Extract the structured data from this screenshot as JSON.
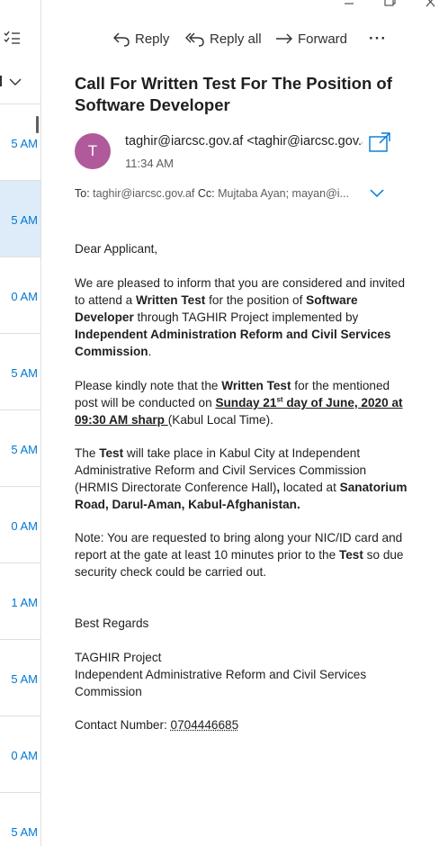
{
  "window": {
    "controls": [
      "minimize-icon",
      "restore-icon",
      "close-icon"
    ]
  },
  "list_pane": {
    "times": [
      "5 AM",
      "5 AM",
      "0 AM",
      "5 AM",
      "5 AM",
      "0 AM",
      "1 AM",
      "5 AM",
      "0 AM",
      "5 AM"
    ],
    "selected_index": 1
  },
  "toolbar": {
    "reply_label": "Reply",
    "reply_all_label": "Reply all",
    "forward_label": "Forward",
    "more_label": "···"
  },
  "message": {
    "subject": "Call For Written Test For The Position of Software Developer",
    "avatar_initial": "T",
    "avatar_color": "#b05a9b",
    "sender": "taghir@iarcsc.gov.af  <taghir@iarcsc.gov.af>",
    "time": "11:34 AM",
    "to_label": "To:",
    "to_value": "taghir@iarcsc.gov.af",
    "cc_label": "Cc:",
    "cc_value": "Mujtaba Ayan; mayan@i..."
  },
  "body": {
    "greeting": "Dear Applicant,",
    "p1_a": "We are pleased to inform that you are considered and invited to attend a ",
    "p1_b": "Written Test",
    "p1_c": " for the position of ",
    "p1_d": "Software Developer",
    "p1_e": " through TAGHIR Project implemented by ",
    "p1_f": "Independent Administration Reform and Civil Services Commission",
    "p1_g": ".",
    "p2_a": "Please kindly note that the ",
    "p2_b": "Written Test",
    "p2_c": " for the mentioned post will be conducted on ",
    "p2_d": "Sunday 21",
    "p2_sup": "st",
    "p2_e": " day of June, 2020 at 09:30 AM sharp ",
    "p2_f": "(Kabul Local Time).",
    "p3_a": "The ",
    "p3_b": "Test",
    "p3_c": " will take place in Kabul City at Independent Administrative Reform and Civil Services Commission (HRMIS Directorate Conference Hall)",
    "p3_d": ",",
    "p3_e": " located at ",
    "p3_f": "Sanatorium Road, Darul-Aman, Kabul-Afghanistan.",
    "p4_a": "Note: You are requested to bring along your NIC/ID card and report at the gate at least 10 minutes prior to the ",
    "p4_b": "Test",
    "p4_c": " so due security check could be carried out.",
    "regards": "Best Regards",
    "sig_1": "TAGHIR Project",
    "sig_2": "Independent Administrative Reform and Civil Services Commission",
    "contact_label": "Contact Number: ",
    "contact_number": "0704446685"
  },
  "colors": {
    "accent": "#0078d4",
    "selected_row": "#deecf9"
  }
}
